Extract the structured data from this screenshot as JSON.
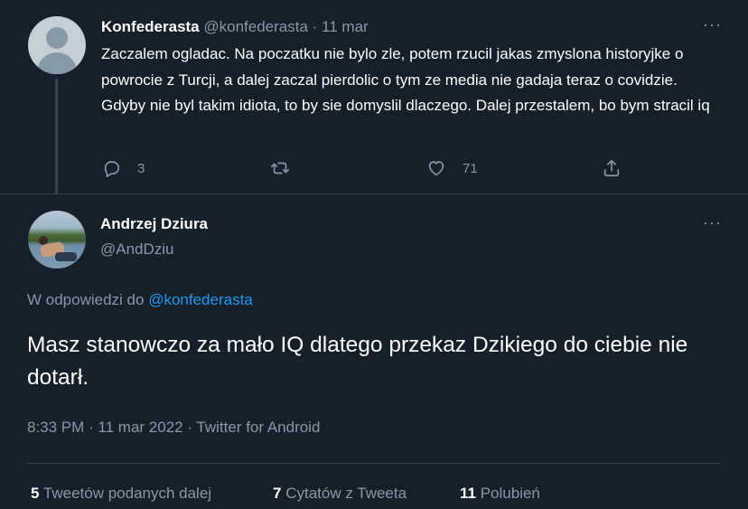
{
  "reply_tweet": {
    "display_name": "Konfederasta",
    "handle": "@konfederasta",
    "date": "· 11 mar",
    "text": "Zaczalem ogladac. Na poczatku nie bylo zle, potem rzucil jakas zmyslona historyjke o powrocie z Turcji, a dalej zaczal pierdolic o tym ze media nie gadaja teraz o covidzie. Gdyby nie byl takim idiota, to by sie domyslil dlaczego. Dalej przestalem, bo bym stracil iq",
    "reply_count": "3",
    "retweet_count": "",
    "like_count": "71",
    "more_label": "···"
  },
  "main_tweet": {
    "display_name": "Andrzej Dziura",
    "handle": "@AndDziu",
    "more_label": "···",
    "reply_prefix": "W odpowiedzi do",
    "reply_mention": "@konfederasta",
    "text": "Masz stanowczo za mało IQ dlatego przekaz Dzikiego do ciebie nie dotarł.",
    "time": "8:33 PM · 11 mar 2022 · Twitter for Android",
    "stats": {
      "retweets_num": "5",
      "retweets_label": "Tweetów podanych dalej",
      "quotes_num": "7",
      "quotes_label": "Cytatów z Tweeta",
      "likes_num": "11",
      "likes_label": "Polubień"
    }
  },
  "icons": {
    "reply": "reply-icon",
    "retweet": "retweet-icon",
    "like": "heart-icon",
    "share": "share-icon",
    "more": "more-icon"
  },
  "colors": {
    "background": "#15202b",
    "divider": "#38444d",
    "secondary_text": "#8b98a5",
    "link": "#1d9bf0",
    "primary_text": "#ffffff"
  }
}
